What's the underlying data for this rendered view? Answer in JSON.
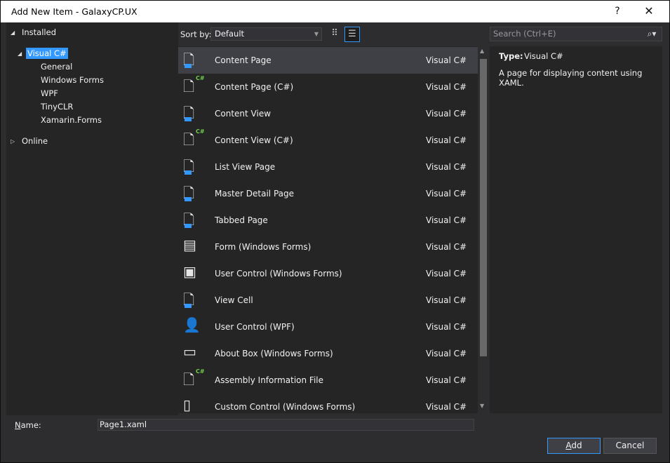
{
  "window": {
    "title": "Add New Item - GalaxyCP.UX",
    "help": "?",
    "close": "✕"
  },
  "tree": {
    "installed": "Installed",
    "visual_csharp": "Visual C#",
    "children": [
      "General",
      "Windows Forms",
      "WPF",
      "TinyCLR",
      "Xamarin.Forms"
    ],
    "online": "Online"
  },
  "toolbar": {
    "sort_label": "Sort by:",
    "sort_value": "Default"
  },
  "items": [
    {
      "name": "Content Page",
      "lang": "Visual C#",
      "icon": "xaml-page-icon"
    },
    {
      "name": "Content Page (C#)",
      "lang": "Visual C#",
      "icon": "csharp-page-icon"
    },
    {
      "name": "Content View",
      "lang": "Visual C#",
      "icon": "xaml-page-icon"
    },
    {
      "name": "Content View (C#)",
      "lang": "Visual C#",
      "icon": "csharp-page-icon"
    },
    {
      "name": "List View Page",
      "lang": "Visual C#",
      "icon": "xaml-page-icon"
    },
    {
      "name": "Master Detail Page",
      "lang": "Visual C#",
      "icon": "xaml-page-icon"
    },
    {
      "name": "Tabbed Page",
      "lang": "Visual C#",
      "icon": "xaml-page-icon"
    },
    {
      "name": "Form (Windows Forms)",
      "lang": "Visual C#",
      "icon": "form-icon"
    },
    {
      "name": "User Control (Windows Forms)",
      "lang": "Visual C#",
      "icon": "user-control-icon"
    },
    {
      "name": "View Cell",
      "lang": "Visual C#",
      "icon": "xaml-page-icon"
    },
    {
      "name": "User Control (WPF)",
      "lang": "Visual C#",
      "icon": "user-icon"
    },
    {
      "name": "About Box (Windows Forms)",
      "lang": "Visual C#",
      "icon": "about-box-icon"
    },
    {
      "name": "Assembly Information File",
      "lang": "Visual C#",
      "icon": "info-file-icon"
    },
    {
      "name": "Custom Control (Windows Forms)",
      "lang": "Visual C#",
      "icon": "custom-control-icon"
    }
  ],
  "search": {
    "placeholder": "Search (Ctrl+E)"
  },
  "details": {
    "type_label": "Type:",
    "type_value": "Visual C#",
    "description": "A page for displaying content using XAML."
  },
  "name_field": {
    "label_prefix": "N",
    "label_rest": "ame:",
    "value": "Page1.xaml"
  },
  "buttons": {
    "add_prefix": "A",
    "add_rest": "dd",
    "cancel": "Cancel"
  },
  "colors": {
    "accent": "#3399ff",
    "background": "#2d2d30",
    "panel": "#252526",
    "selected_row": "#3f3f46"
  }
}
